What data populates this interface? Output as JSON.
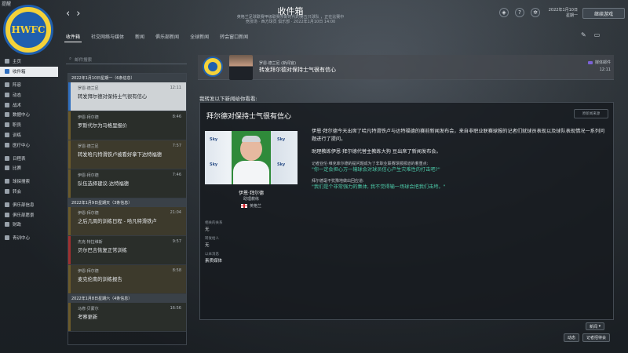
{
  "app": {
    "corner_label": "提醒",
    "title": "收件箱",
    "subtitle_line1": "英格兰足球联赛甲级联赛奈斯时代的第五只球队 ，正在比赛中",
    "subtitle_line2": "竞技场 · 西方球员 俱乐部 · 2022年1月10日 14:00",
    "logo_text": "HWFC",
    "date_line1": "2022年1月10日",
    "date_line2": "星期一",
    "continue_label": "继续游戏"
  },
  "nav": {
    "back": "‹",
    "forward": "›"
  },
  "tabs": [
    {
      "label": "收件箱",
      "active": true
    },
    {
      "label": "社交网络与媒体",
      "active": false
    },
    {
      "label": "新闻",
      "active": false
    },
    {
      "label": "俱乐部新闻",
      "active": false
    },
    {
      "label": "全球新闻",
      "active": false
    },
    {
      "label": "转会窗口新闻",
      "active": false
    }
  ],
  "sidebar": {
    "items": [
      {
        "label": "主页",
        "active": false
      },
      {
        "label": "收件箱",
        "active": true
      },
      {
        "label": "阵容",
        "active": false
      },
      {
        "label": "动态",
        "active": false
      },
      {
        "label": "战术",
        "active": false
      },
      {
        "label": "数据中心",
        "active": false
      },
      {
        "label": "职员",
        "active": false
      },
      {
        "label": "训练",
        "active": false
      },
      {
        "label": "医疗中心",
        "active": false
      },
      {
        "label": "日程表",
        "active": false
      },
      {
        "label": "比赛",
        "active": false
      },
      {
        "label": "球探搜索",
        "active": false
      },
      {
        "label": "转会",
        "active": false
      },
      {
        "label": "俱乐部信息",
        "active": false
      },
      {
        "label": "俱乐部愿景",
        "active": false
      },
      {
        "label": "财政",
        "active": false
      },
      {
        "label": "青训中心",
        "active": false
      }
    ]
  },
  "search": {
    "placeholder": "邮件搜索"
  },
  "messages": {
    "day1": "2022年1月10日星期一（6条信息）",
    "day2": "2022年1月9日星期天（3条信息）",
    "day3": "2022年1月8日星期六（4条信息）",
    "items": [
      {
        "sender": "罗恩·德兰尼",
        "subject": "转发拜尔德对保持士气很有信心",
        "time": "12:11"
      },
      {
        "sender": "伊恩·拜尔德",
        "subject": "罗斯代尔为马格里报价",
        "time": "8:46"
      },
      {
        "sender": "罗恩·德兰尼",
        "subject": "转发哈凡特滑铁卢被看好拿下达特福德",
        "time": "7:57"
      },
      {
        "sender": "伊恩·拜尔德",
        "subject": "队伍选择建议:达特福德",
        "time": "7:46"
      },
      {
        "sender": "伊恩·拜尔德",
        "subject": "之后几周的训练日程 - 哈凡特滑铁卢",
        "time": "21:04"
      },
      {
        "sender": "杰克·特拉维斯",
        "subject": "贝尔巴吉恢复正常训练",
        "time": "9:57"
      },
      {
        "sender": "伊恩·拜尔德",
        "subject": "麦克伦南的训练报告",
        "time": "8:58"
      },
      {
        "sender": "马修·贝蒙尔",
        "subject": "考察更新",
        "time": "16:56"
      }
    ]
  },
  "header": {
    "from": "罗恩·德兰尼 (新闻官)",
    "subject": "转发拜尔德对保持士气很有信心",
    "tag": "媒体邮件",
    "time": "12:11"
  },
  "forward_text": "我转发以下新闻给你看看:",
  "news": {
    "title": "拜尔德对保持士气很有信心",
    "source_button": "原新闻来源",
    "photo_words": [
      "Sky",
      "Sky",
      "Sky",
      "Sky"
    ],
    "person_name": "伊恩·拜尔德",
    "person_role": "助理教练",
    "person_nation": "英格兰",
    "meta": [
      {
        "label": "相关的关系",
        "value": "无"
      },
      {
        "label": "转发给人",
        "value": "无"
      },
      {
        "label": "以本消息",
        "value": "素质媒体"
      }
    ],
    "para1": "伊恩·拜尔德今天出席了哈凡特滑铁卢与达特福德的赛前新闻发布会，来自非职业联赛球报的记者们就球员表现以及球队表现情况一系列问题进行了提问。",
    "para2": "助理教练伊恩·拜尔德代替主教练大狗 豆出席了新闻发布会。",
    "q1": "记者亚伦·维克菲尔德的提问题成为了非职业联赛球报报道的着重点:",
    "a1": "\"你一定会担心万一输球会对球员信心产生灾难性的打击吧?\"",
    "q2": "拜尔德毫不犹豫地做出回应道:",
    "a2": "\"我们是个非常强力的集体, 我不觉得输一场球会把我们击垮。\""
  },
  "footer": {
    "new_label": "新闻",
    "btn1": "动态",
    "btn2": "记者招待会"
  }
}
